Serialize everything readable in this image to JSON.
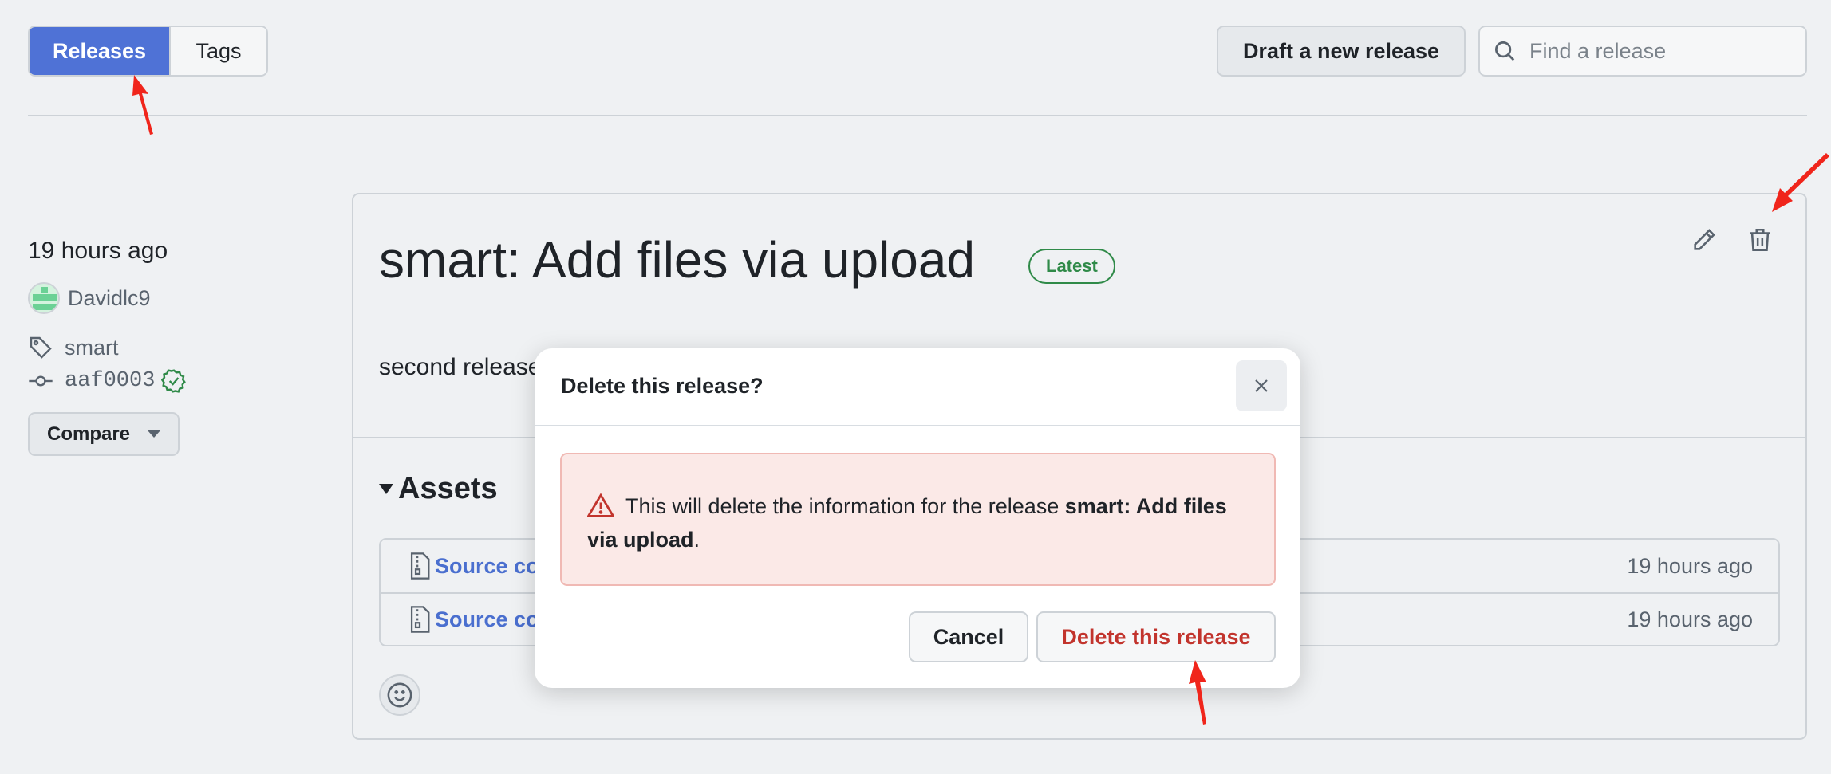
{
  "header": {
    "tabs": [
      {
        "label": "Releases",
        "active": true
      },
      {
        "label": "Tags",
        "active": false
      }
    ],
    "draft_button": "Draft a new release",
    "search_placeholder": "Find a release"
  },
  "sidebar": {
    "time": "19 hours ago",
    "author": "Davidlc9",
    "tag": "smart",
    "commit": "aaf0003",
    "compare_label": "Compare"
  },
  "release": {
    "title": "smart: Add files via upload",
    "badge": "Latest",
    "body": "second release",
    "assets_heading": "Assets",
    "assets": [
      {
        "name": "Source code (zip)",
        "time": "19 hours ago"
      },
      {
        "name": "Source code (tar.gz)",
        "time": "19 hours ago"
      }
    ]
  },
  "modal": {
    "title": "Delete this release?",
    "message_prefix": "This will delete the information for the release ",
    "message_bold": "smart: Add files via upload",
    "message_suffix": ".",
    "cancel_label": "Cancel",
    "confirm_label": "Delete this release"
  },
  "colors": {
    "accent": "#4f72d6",
    "danger": "#c2342d",
    "success": "#2f8a48",
    "annotation": "#f0251b"
  }
}
